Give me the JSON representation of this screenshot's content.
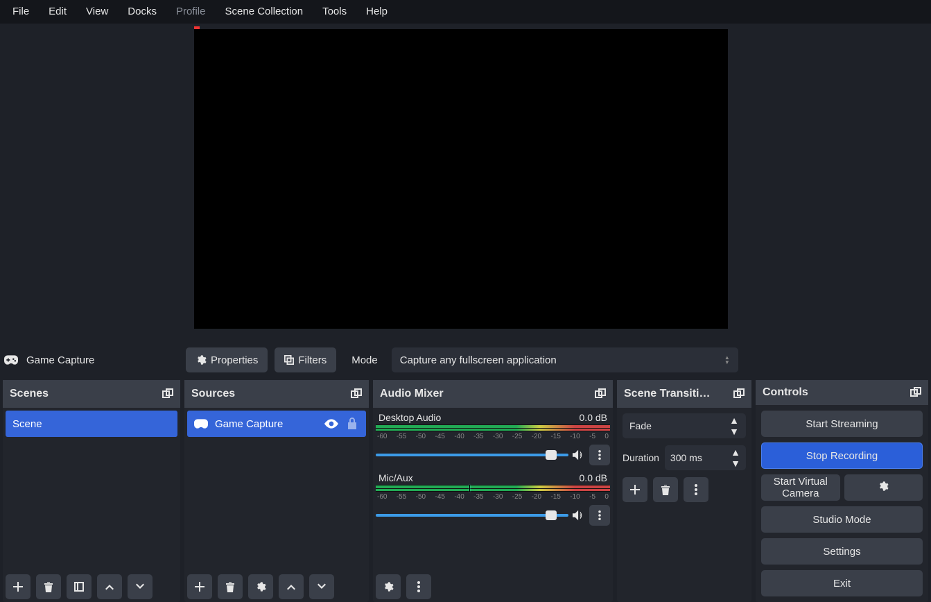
{
  "menu": [
    "File",
    "Edit",
    "View",
    "Docks",
    "Profile",
    "Scene Collection",
    "Tools",
    "Help"
  ],
  "menu_dim_index": 4,
  "context": {
    "source_name": "Game Capture",
    "properties_label": "Properties",
    "filters_label": "Filters",
    "mode_label": "Mode",
    "mode_value": "Capture any fullscreen application"
  },
  "docks": {
    "scenes": {
      "title": "Scenes",
      "items": [
        "Scene"
      ]
    },
    "sources": {
      "title": "Sources",
      "items": [
        {
          "name": "Game Capture",
          "visible": true,
          "locked": false
        }
      ]
    },
    "mixer": {
      "title": "Audio Mixer",
      "ticks": [
        "-60",
        "-55",
        "-50",
        "-45",
        "-40",
        "-35",
        "-30",
        "-25",
        "-20",
        "-15",
        "-10",
        "-5",
        "0"
      ],
      "tracks": [
        {
          "name": "Desktop Audio",
          "db": "0.0 dB"
        },
        {
          "name": "Mic/Aux",
          "db": "0.0 dB"
        }
      ]
    },
    "transitions": {
      "title": "Scene Transiti…",
      "selected": "Fade",
      "duration_label": "Duration",
      "duration_value": "300 ms"
    },
    "controls": {
      "title": "Controls",
      "buttons": {
        "start_streaming": "Start Streaming",
        "stop_recording": "Stop Recording",
        "start_vcam": "Start Virtual Camera",
        "studio_mode": "Studio Mode",
        "settings": "Settings",
        "exit": "Exit"
      }
    }
  }
}
